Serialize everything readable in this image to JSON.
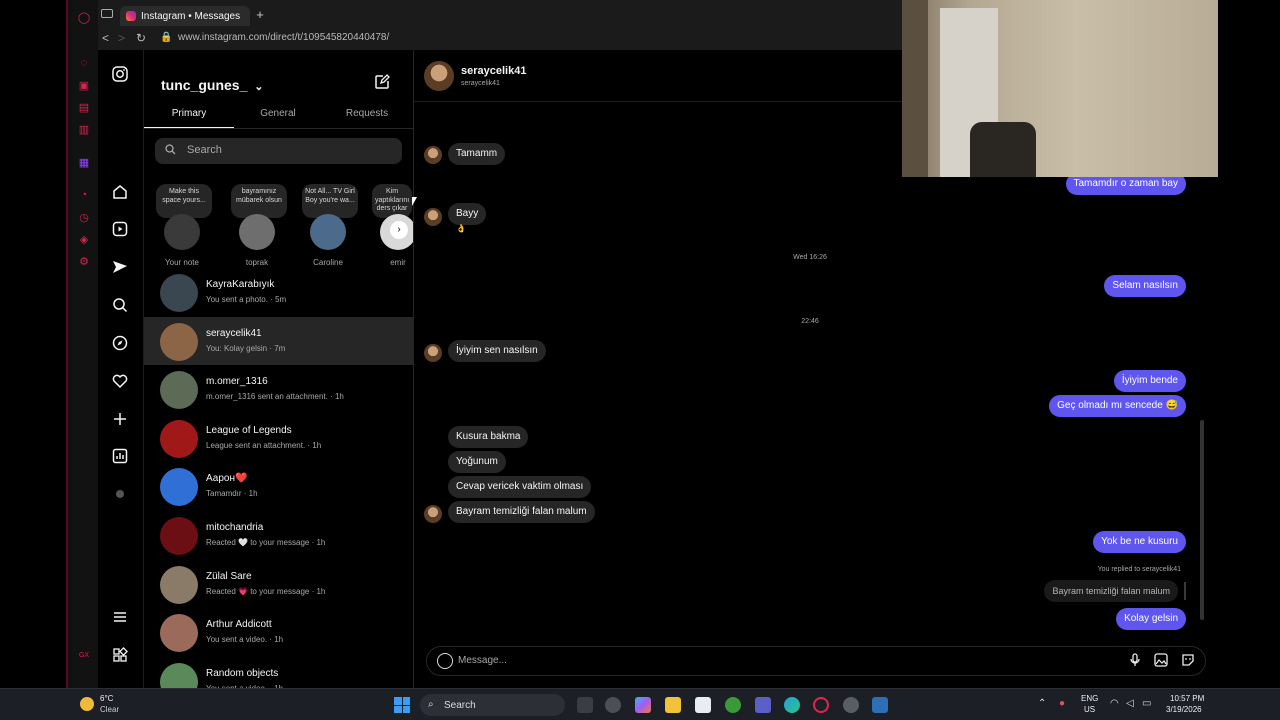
{
  "browser": {
    "tab_title": "Instagram • Messages",
    "new_tab_symbol": "+",
    "url": "www.instagram.com/direct/t/109545820440478/",
    "back": "<",
    "forward": ">",
    "reload": "↻",
    "lock": "🔒"
  },
  "inbox": {
    "username": "tunc_gunes_",
    "username_chevron": "⌄",
    "compose_icon": "✎",
    "tabs": [
      "Primary",
      "General",
      "Requests"
    ],
    "search_placeholder": "Search",
    "notes": [
      {
        "bubble": "Make this space yours...",
        "name": "Your note",
        "avatar_color": "#3a3a3a"
      },
      {
        "bubble": "bayramınız mübarek olsun",
        "name": "toprak",
        "avatar_color": "#6e6e6e"
      },
      {
        "bubble": "Not All... TV Girl Boy you're wa...",
        "name": "Caroline",
        "avatar_color": "#4c6a8c"
      },
      {
        "bubble": "Kim yaptıklarını ders çıkar",
        "name": "emir",
        "avatar_color": "#d9d9d9"
      }
    ],
    "notes_next": "›",
    "conversations": [
      {
        "name": "KayraKarabıyık",
        "preview": "You sent a photo. · 5m",
        "avatar_color": "#3a4650",
        "active": false
      },
      {
        "name": "seraycelik41",
        "preview": "You: Kolay gelsin · 7m",
        "avatar_color": "#8c6446",
        "active": true
      },
      {
        "name": "m.omer_1316",
        "preview": "m.omer_1316 sent an attachment. · 1h",
        "avatar_color": "#5d6a55",
        "active": false
      },
      {
        "name": "League of Legends",
        "preview": "League sent an attachment. · 1h",
        "avatar_color": "#a01818",
        "active": false
      },
      {
        "name": "Аарон❤️",
        "preview": "Tamamdır · 1h",
        "avatar_color": "#2f6fd6",
        "active": false
      },
      {
        "name": "mitochandria",
        "preview": "Reacted 🤍 to your message · 1h",
        "avatar_color": "#6b0f14",
        "active": false
      },
      {
        "name": "Zülal Sare",
        "preview": "Reacted 💗 to your message · 1h",
        "avatar_color": "#8a7b69",
        "active": false
      },
      {
        "name": "Arthur Addicott",
        "preview": "You sent a video. · 1h",
        "avatar_color": "#9a6a5a",
        "active": false
      },
      {
        "name": "Random objects",
        "preview": "You sent a video. · 1h",
        "avatar_color": "#5a8a5a",
        "active": false
      }
    ]
  },
  "chat": {
    "name": "seraycelik41",
    "handle": "seraycelik41",
    "incoming_1": "Tamamm",
    "incoming_2": "Bayy",
    "reaction": "👌",
    "outgoing_1": "Tamamdır o zaman bay",
    "stamp_1": "Wed 16:26",
    "outgoing_2": "Selam nasılsın",
    "stamp_2": "22:46",
    "incoming_3": "İyiyim sen nasılsın",
    "outgoing_3": "İyiyim bende",
    "outgoing_4": "Geç olmadı mı sencede 😅",
    "incoming_4": "Kusura bakma",
    "incoming_5": "Yoğunum",
    "incoming_6": "Cevap vericek vaktim olması",
    "incoming_7": "Bayram temizliği falan malum",
    "outgoing_5": "Yok be ne kusuru",
    "reply_label": "You replied to seraycelik41",
    "reply_quote": "Bayram temizliği falan malum",
    "outgoing_6": "Kolay gelsin",
    "message_placeholder": "Message...",
    "accent": "#5f56f0"
  },
  "taskbar": {
    "weather_temp": "6°C",
    "weather_desc": "Clear",
    "search_label": "Search",
    "lang_1": "ENG",
    "lang_2": "US",
    "time": "10:57 PM",
    "date": "3/19/2026"
  }
}
